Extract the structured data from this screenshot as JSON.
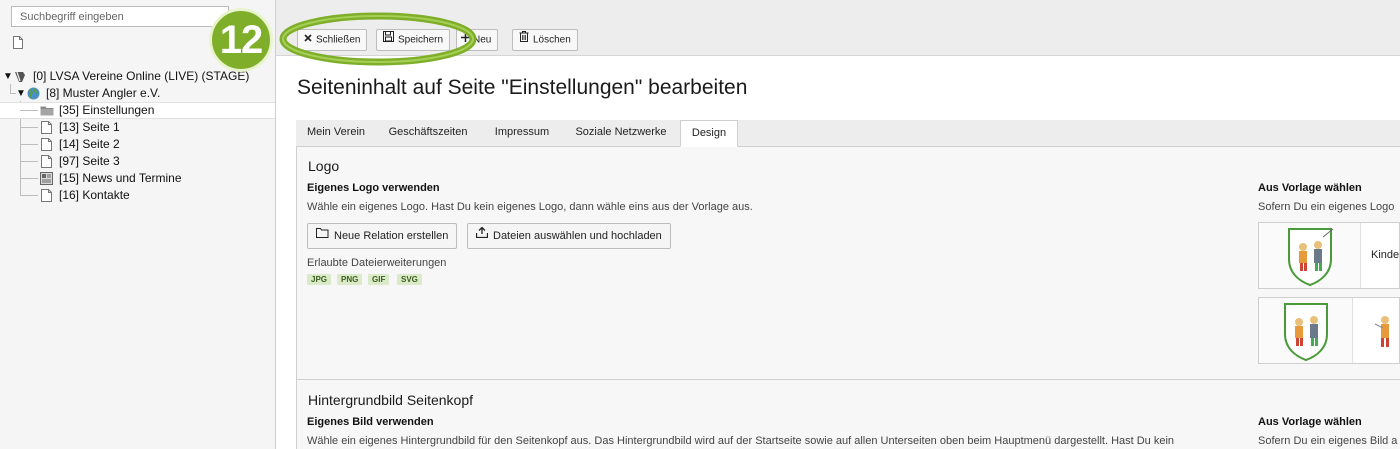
{
  "search": {
    "placeholder": "Suchbegriff eingeben"
  },
  "tree": [
    {
      "label": "[0] LVSA Vereine Online (LIVE) (STAGE)",
      "icon": "typo3-logo-icon"
    },
    {
      "label": "[8] Muster Angler e.V.",
      "icon": "globe-icon"
    },
    {
      "label": "[35] Einstellungen",
      "icon": "folder-icon"
    },
    {
      "label": "[13] Seite 1",
      "icon": "page-icon"
    },
    {
      "label": "[14] Seite 2",
      "icon": "page-icon"
    },
    {
      "label": "[97] Seite 3",
      "icon": "page-icon"
    },
    {
      "label": "[15] News und Termine",
      "icon": "news-folder-icon"
    },
    {
      "label": "[16] Kontakte",
      "icon": "page-icon"
    }
  ],
  "toolbar": {
    "close_label": "Schließen",
    "save_label": "Speichern",
    "new_label": "Neu",
    "delete_label": "Löschen"
  },
  "annotation": {
    "step_number": "12",
    "accent_color": "#7faf2a"
  },
  "main": {
    "title": "Seiteninhalt auf Seite \"Einstellungen\" bearbeiten",
    "tabs": [
      "Mein Verein",
      "Geschäftszeiten",
      "Impressum",
      "Soziale Netzwerke",
      "Design"
    ],
    "active_tab": "Design",
    "logo_section": {
      "heading": "Logo",
      "own_title": "Eigenes Logo verwenden",
      "own_desc": "Wähle ein eigenes Logo. Hast Du kein eigenes Logo, dann wähle eins aus der Vorlage aus.",
      "btn_new_relation": "Neue Relation erstellen",
      "btn_upload": "Dateien auswählen und hochladen",
      "allowed_label": "Erlaubte Dateierweiterungen",
      "extensions": [
        "JPG",
        "PNG",
        "GIF",
        "SVG"
      ],
      "template_title": "Aus Vorlage wählen",
      "template_desc": "Sofern Du ein eigenes Logo",
      "template_item_label": "Kinde"
    },
    "header_image_section": {
      "heading": "Hintergrundbild Seitenkopf",
      "own_title": "Eigenes Bild verwenden",
      "own_desc": "Wähle ein eigenes Hintergrundbild für den Seitenkopf aus. Das Hintergrundbild wird auf der Startseite sowie auf allen Unterseiten oben beim Hauptmenü dargestellt. Hast Du kein",
      "template_title": "Aus Vorlage wählen",
      "template_desc": "Sofern Du ein eigenes Bild a"
    }
  }
}
